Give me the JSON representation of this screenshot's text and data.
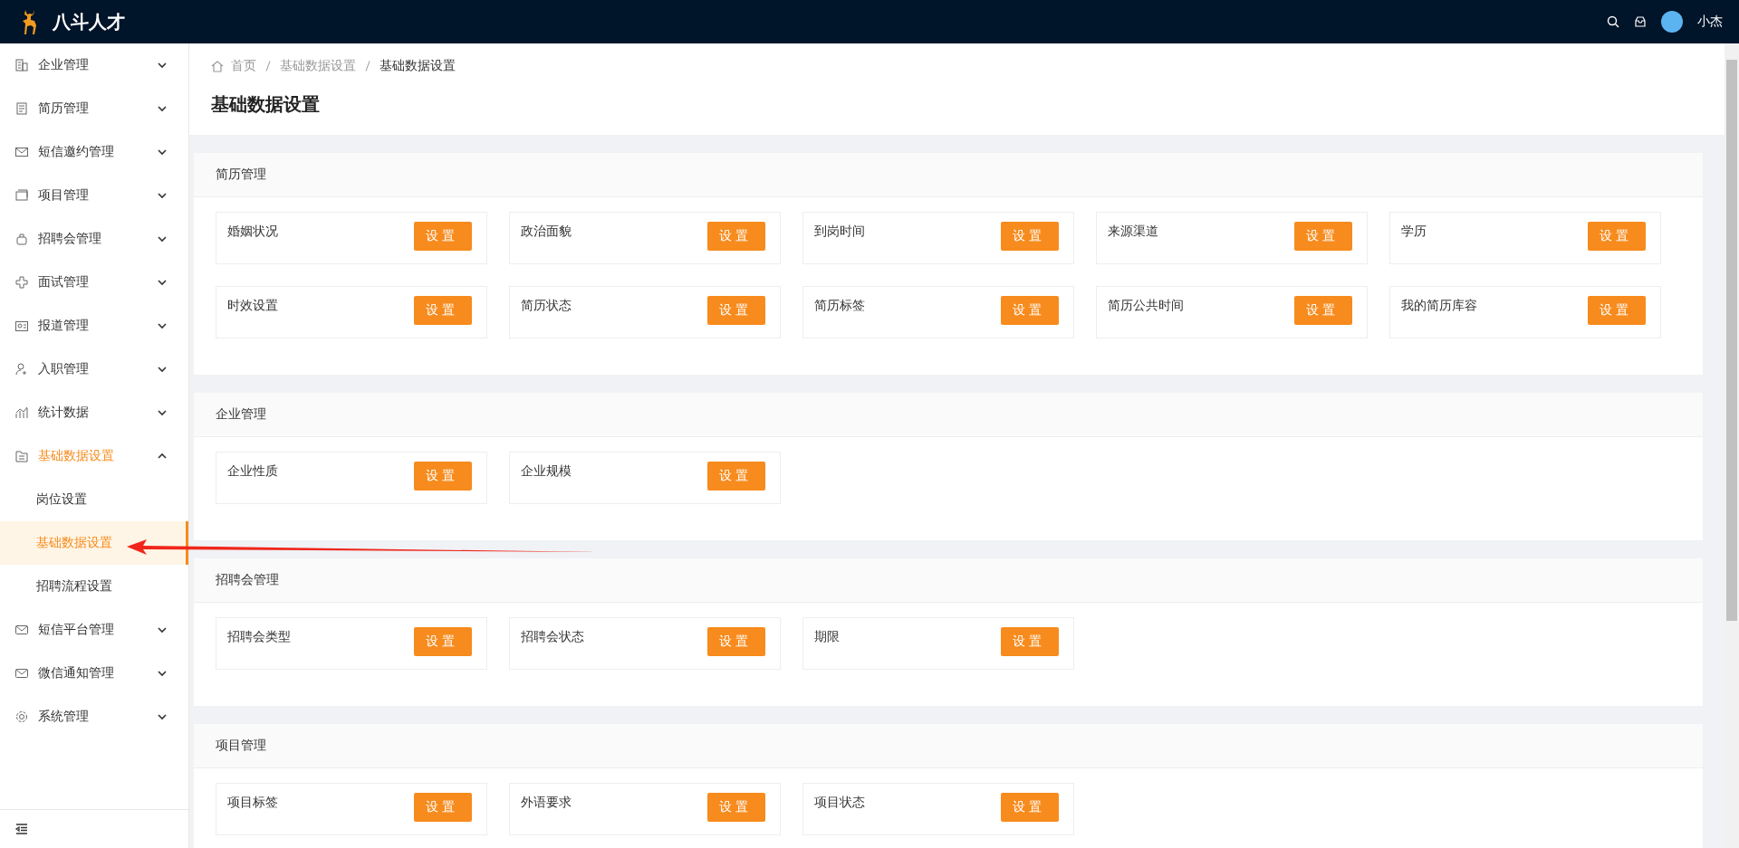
{
  "topbar": {
    "brand": "八斗人才",
    "user": "小杰"
  },
  "sidebar": {
    "items": [
      {
        "label": "企业管理",
        "expanded": false
      },
      {
        "label": "简历管理",
        "expanded": false
      },
      {
        "label": "短信邀约管理",
        "expanded": false
      },
      {
        "label": "项目管理",
        "expanded": false
      },
      {
        "label": "招聘会管理",
        "expanded": false
      },
      {
        "label": "面试管理",
        "expanded": false
      },
      {
        "label": "报道管理",
        "expanded": false
      },
      {
        "label": "入职管理",
        "expanded": false
      },
      {
        "label": "统计数据",
        "expanded": false
      },
      {
        "label": "基础数据设置",
        "expanded": true,
        "children": [
          {
            "label": "岗位设置",
            "selected": false
          },
          {
            "label": "基础数据设置",
            "selected": true
          },
          {
            "label": "招聘流程设置",
            "selected": false
          }
        ]
      },
      {
        "label": "短信平台管理",
        "expanded": false
      },
      {
        "label": "微信通知管理",
        "expanded": false
      },
      {
        "label": "系统管理",
        "expanded": false
      }
    ]
  },
  "breadcrumb": [
    "首页",
    "基础数据设置",
    "基础数据设置"
  ],
  "page_title": "基础数据设置",
  "sections": [
    {
      "title": "简历管理",
      "items": [
        {
          "label": "婚姻状况",
          "button": "设置"
        },
        {
          "label": "政治面貌",
          "button": "设置"
        },
        {
          "label": "到岗时间",
          "button": "设置"
        },
        {
          "label": "来源渠道",
          "button": "设置"
        },
        {
          "label": "学历",
          "button": "设置"
        },
        {
          "label": "时效设置",
          "button": "设置"
        },
        {
          "label": "简历状态",
          "button": "设置"
        },
        {
          "label": "简历标签",
          "button": "设置"
        },
        {
          "label": "简历公共时间",
          "button": "设置"
        },
        {
          "label": "我的简历库容",
          "button": "设置"
        }
      ]
    },
    {
      "title": "企业管理",
      "items": [
        {
          "label": "企业性质",
          "button": "设置"
        },
        {
          "label": "企业规模",
          "button": "设置"
        }
      ]
    },
    {
      "title": "招聘会管理",
      "items": [
        {
          "label": "招聘会类型",
          "button": "设置"
        },
        {
          "label": "招聘会状态",
          "button": "设置"
        },
        {
          "label": "期限",
          "button": "设置"
        }
      ]
    },
    {
      "title": "项目管理",
      "items": [
        {
          "label": "项目标签",
          "button": "设置"
        },
        {
          "label": "外语要求",
          "button": "设置"
        },
        {
          "label": "项目状态",
          "button": "设置"
        }
      ]
    }
  ]
}
